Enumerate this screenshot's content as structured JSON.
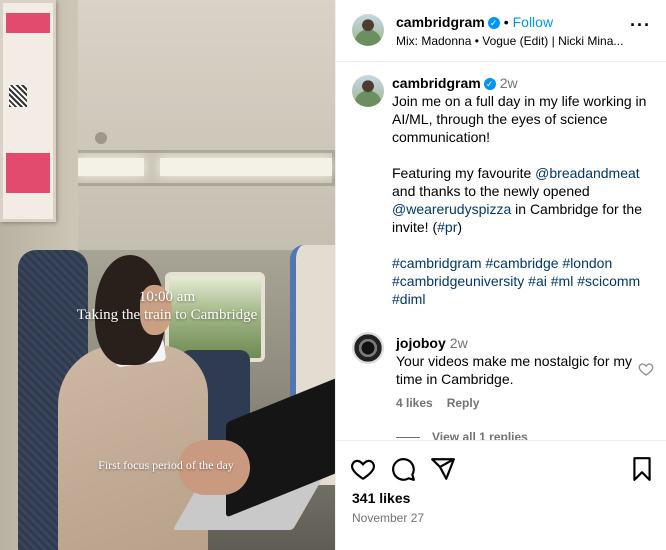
{
  "media": {
    "caption_line1": "10:00 am",
    "caption_line2": "Taking the train to Cambridge",
    "caption_line3": "First focus period of the day"
  },
  "header": {
    "username": "cambridgram",
    "separator": "•",
    "follow_label": "Follow",
    "music": "Mix: Madonna • Vogue (Edit) | Nicki Mina..."
  },
  "caption": {
    "username": "cambridgram",
    "time": "2w",
    "para1": "Join me on a full day in my life working in AI/ML, through the eyes of science communication!",
    "p2_a": "Featuring my favourite ",
    "p2_link1": "@breadandmeat",
    "p2_b": " and thanks to the newly opened ",
    "p2_link2": "@wearerudyspizza",
    "p2_c": " in Cambridge for the invite! (",
    "p2_tag": "#pr",
    "p2_d": ")",
    "hashtags": "#cambridgram #cambridge #london #cambridgeuniversity #ai #ml #scicomm #diml"
  },
  "comment": {
    "username": "jojoboy",
    "time": "2w",
    "text": "Your videos make me nostalgic for my time in Cambridge.",
    "likes": "4 likes",
    "reply_label": "Reply",
    "view_replies": "View all 1 replies"
  },
  "footer": {
    "likes": "341 likes",
    "date": "November 27"
  },
  "icons": {
    "like": "heart-icon",
    "comment": "comment-icon",
    "share": "share-icon",
    "save": "bookmark-icon",
    "more": "more-icon",
    "verified": "verified-badge-icon"
  },
  "colors": {
    "link": "#00376b",
    "follow": "#0095f6",
    "secondary": "#737373"
  }
}
